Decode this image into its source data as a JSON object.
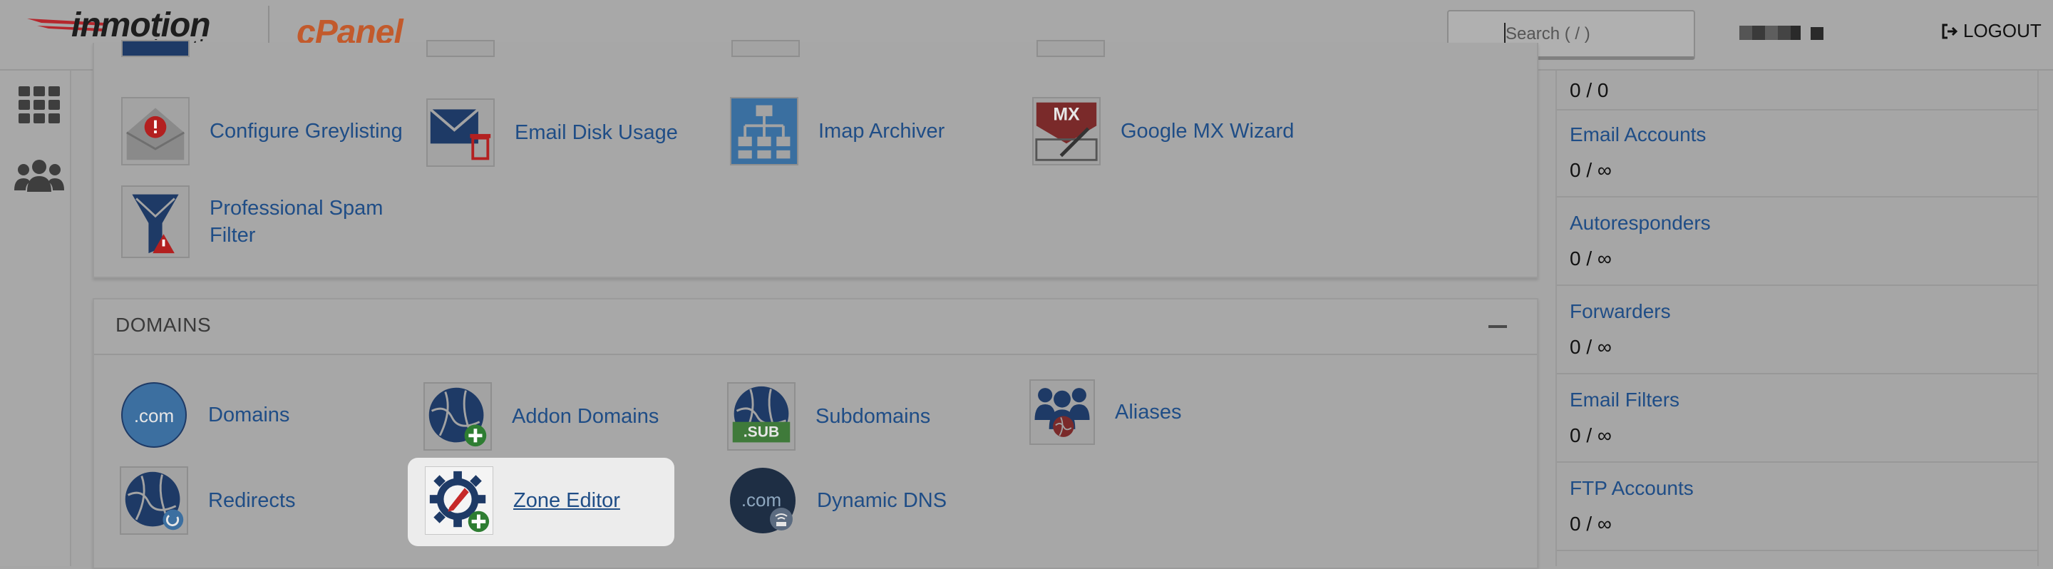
{
  "header": {
    "brand_name": "inmotion",
    "brand_sub": "hosting",
    "product": "cPanel",
    "search_placeholder": "Search ( / )",
    "logout_label": "LOGOUT"
  },
  "email_section": {
    "items": [
      {
        "label": "Configure Greylisting",
        "icon": "greylisting-icon"
      },
      {
        "label": "Email Disk Usage",
        "icon": "email-disk-usage-icon"
      },
      {
        "label": "Imap Archiver",
        "icon": "imap-archiver-icon"
      },
      {
        "label": "Google MX Wizard",
        "icon": "google-mx-wizard-icon",
        "icon_text": "MX"
      },
      {
        "label": "Professional Spam Filter",
        "icon": "spam-filter-icon"
      }
    ]
  },
  "domains_section": {
    "title": "DOMAINS",
    "items": [
      {
        "label": "Domains",
        "icon": "domains-icon",
        "icon_text": ".com"
      },
      {
        "label": "Addon Domains",
        "icon": "addon-domains-icon"
      },
      {
        "label": "Subdomains",
        "icon": "subdomains-icon",
        "icon_text": ".SUB"
      },
      {
        "label": "Aliases",
        "icon": "aliases-icon"
      },
      {
        "label": "Redirects",
        "icon": "redirects-icon"
      },
      {
        "label": "Zone Editor",
        "icon": "zone-editor-icon"
      },
      {
        "label": "Dynamic DNS",
        "icon": "dynamic-dns-icon",
        "icon_text": ".com"
      }
    ]
  },
  "stats": {
    "top_value": "0 / 0",
    "items": [
      {
        "name": "Email Accounts",
        "value": "0 / ∞"
      },
      {
        "name": "Autoresponders",
        "value": "0 / ∞"
      },
      {
        "name": "Forwarders",
        "value": "0 / ∞"
      },
      {
        "name": "Email Filters",
        "value": "0 / ∞"
      },
      {
        "name": "FTP Accounts",
        "value": "0 / ∞"
      }
    ]
  },
  "colors": {
    "link": "#1f4d86",
    "cpanel_orange": "#c25a2c",
    "brand_red": "#c0262c",
    "overlay_bg": "#a6a6a6",
    "highlight": "#ececec"
  }
}
